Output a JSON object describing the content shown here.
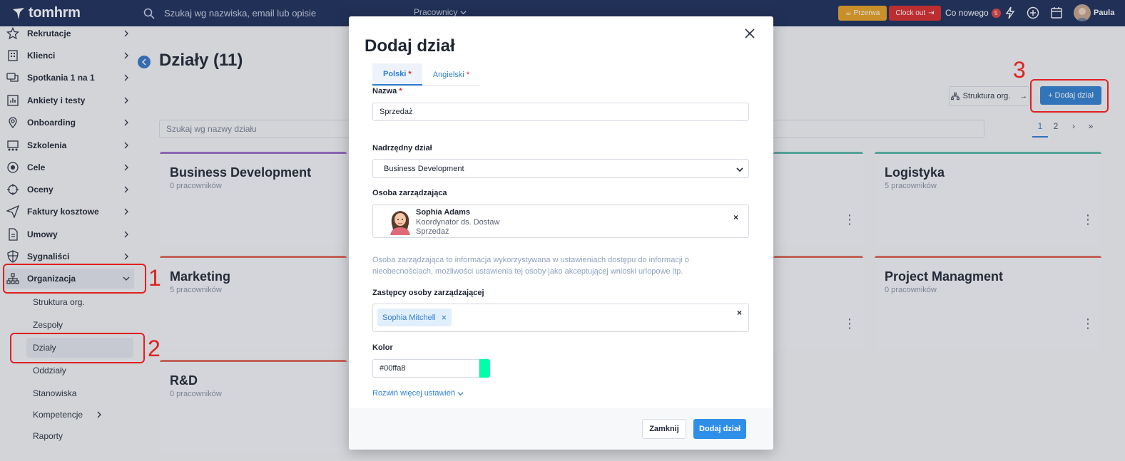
{
  "topbar": {
    "brand": "tomhrm",
    "search_placeholder": "Szukaj wg nazwiska, email lub opisie",
    "search_scope": "Pracownicy",
    "break_label": "Przerwa",
    "clockout_label": "Clock out",
    "whats_new_label": "Co nowego",
    "whats_new_count": "5",
    "user_name": "Paula"
  },
  "sidebar": {
    "items": [
      {
        "label": "Rekrutacje",
        "icon": "star-icon"
      },
      {
        "label": "Klienci",
        "icon": "building-icon"
      },
      {
        "label": "Spotkania 1 na 1",
        "icon": "chat-icon"
      },
      {
        "label": "Ankiety i testy",
        "icon": "bar-chart-icon"
      },
      {
        "label": "Onboarding",
        "icon": "map-pin-icon"
      },
      {
        "label": "Szkolenia",
        "icon": "presentation-icon"
      },
      {
        "label": "Cele",
        "icon": "target-icon"
      },
      {
        "label": "Oceny",
        "icon": "crosshair-icon"
      },
      {
        "label": "Faktury kosztowe",
        "icon": "send-icon"
      },
      {
        "label": "Umowy",
        "icon": "document-icon"
      },
      {
        "label": "Sygnaliści",
        "icon": "shield-icon"
      },
      {
        "label": "Organizacja",
        "icon": "org-chart-icon"
      }
    ],
    "sub_items": [
      {
        "label": "Struktura org."
      },
      {
        "label": "Zespoły"
      },
      {
        "label": "Działy"
      },
      {
        "label": "Oddziały"
      },
      {
        "label": "Stanowiska"
      },
      {
        "label": "Kompetencje"
      },
      {
        "label": "Raporty"
      }
    ]
  },
  "annotations": {
    "one": "1",
    "two": "2",
    "three": "3"
  },
  "main": {
    "title": "Działy (11)",
    "dept_search_placeholder": "Szukaj wg nazwy działu",
    "struct_button": "Struktura org.",
    "add_button": "Dodaj dział",
    "pages": [
      "1",
      "2",
      "›",
      "»"
    ],
    "cards": [
      {
        "name": "Business Development",
        "count": "0 pracowników",
        "color": "#9b6cc9"
      },
      {
        "name": "Marketing",
        "count": "5 pracowników",
        "color": "#e06a5a"
      },
      {
        "name": "R&D",
        "count": "0 pracowników",
        "color": "#e06a5a"
      },
      {
        "name": "Logistyka",
        "count": "5 pracowników",
        "color": "#5ab8a8"
      },
      {
        "name": "Project Managment",
        "count": "0 pracowników",
        "color": "#e06a5a"
      }
    ]
  },
  "modal": {
    "title": "Dodaj dział",
    "tabs": [
      {
        "label": "Polski",
        "required": "*"
      },
      {
        "label": "Angielski",
        "required": "*"
      }
    ],
    "name_label": "Nazwa",
    "name_required": "*",
    "name_value": "Sprzedaż",
    "parent_label": "Nadrzędny dział",
    "parent_value": "Business Development",
    "manager_label": "Osoba zarządzająca",
    "manager": {
      "name": "Sophia Adams",
      "role": "Koordynator ds. Dostaw",
      "department": "Sprzedaż"
    },
    "hint": "Osoba zarządzająca to informacja wykorzystywana w ustawieniach dostępu do informacji o nieobecnościach, możliwości ustawienia tej osoby jako akceptującej wnioski urlopowe itp.",
    "deputies_label": "Zastępcy osoby zarządzającej",
    "deputies": [
      {
        "name": "Sophia Mitchell"
      }
    ],
    "color_label": "Kolor",
    "color_value": "#00ffa8",
    "expand_label": "Rozwiń więcej ustawień",
    "close_button": "Zamknij",
    "submit_button": "Dodaj dział"
  },
  "colors": {
    "topbar": "#1c2d5a",
    "primary": "#2f7fd1",
    "annotation_red": "#e02020",
    "break": "#e8a020",
    "clockout": "#d82a2a"
  }
}
